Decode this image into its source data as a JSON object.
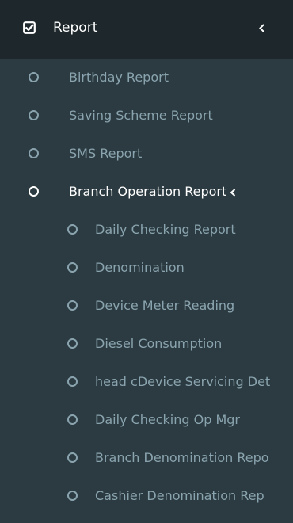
{
  "menu": {
    "header": {
      "label": "Report",
      "icon": "checked-square-icon",
      "expand_icon": "chevron-left-icon"
    },
    "items": [
      {
        "label": "Birthday Report"
      },
      {
        "label": "Saving Scheme Report"
      },
      {
        "label": "SMS Report"
      },
      {
        "label": "Branch Operation Report",
        "active": true
      }
    ],
    "subitems": [
      {
        "label": "Daily Checking Report"
      },
      {
        "label": "Denomination"
      },
      {
        "label": "Device Meter Reading"
      },
      {
        "label": "Diesel Consumption"
      },
      {
        "label": "head cDevice Servicing Det"
      },
      {
        "label": "Daily Checking Op Mgr"
      },
      {
        "label": "Branch Denomination Repo"
      },
      {
        "label": "Cashier Denomination Rep"
      }
    ]
  },
  "colors": {
    "sidebar_bg": "#2c3b41",
    "header_bg": "#1e282c",
    "text_muted": "#8aa4af",
    "text_active": "#ffffff"
  }
}
